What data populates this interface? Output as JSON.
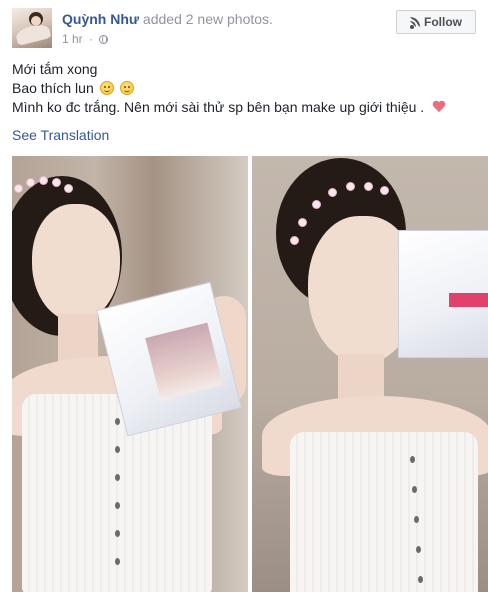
{
  "post": {
    "author_name": "Quỳnh Như",
    "action_text": "added 2 new photos.",
    "timestamp": "1 hr",
    "separator": "·",
    "privacy_icon": "globe-icon",
    "follow_label": "Follow",
    "follow_icon": "rss-icon",
    "lines": [
      {
        "text": "Mới tắm xong",
        "trailing_icons": []
      },
      {
        "text": "Bao thích lun",
        "trailing_icons": [
          "smile-icon",
          "smile-icon"
        ]
      },
      {
        "text": "Mình ko đc trắng. Nên mới sài thử sp bên bạn make up giới thiệu .",
        "trailing_icons": [
          "heart-icon"
        ]
      }
    ],
    "see_translation": "See Translation",
    "photos": [
      {
        "description_icon": "photo-icon"
      },
      {
        "description_icon": "photo-icon"
      }
    ]
  },
  "colors": {
    "link": "#365899",
    "meta_gray": "#90949c",
    "body_text": "#1d2129",
    "button_bg": "#f6f7f9",
    "heart": "#e86f7c"
  }
}
